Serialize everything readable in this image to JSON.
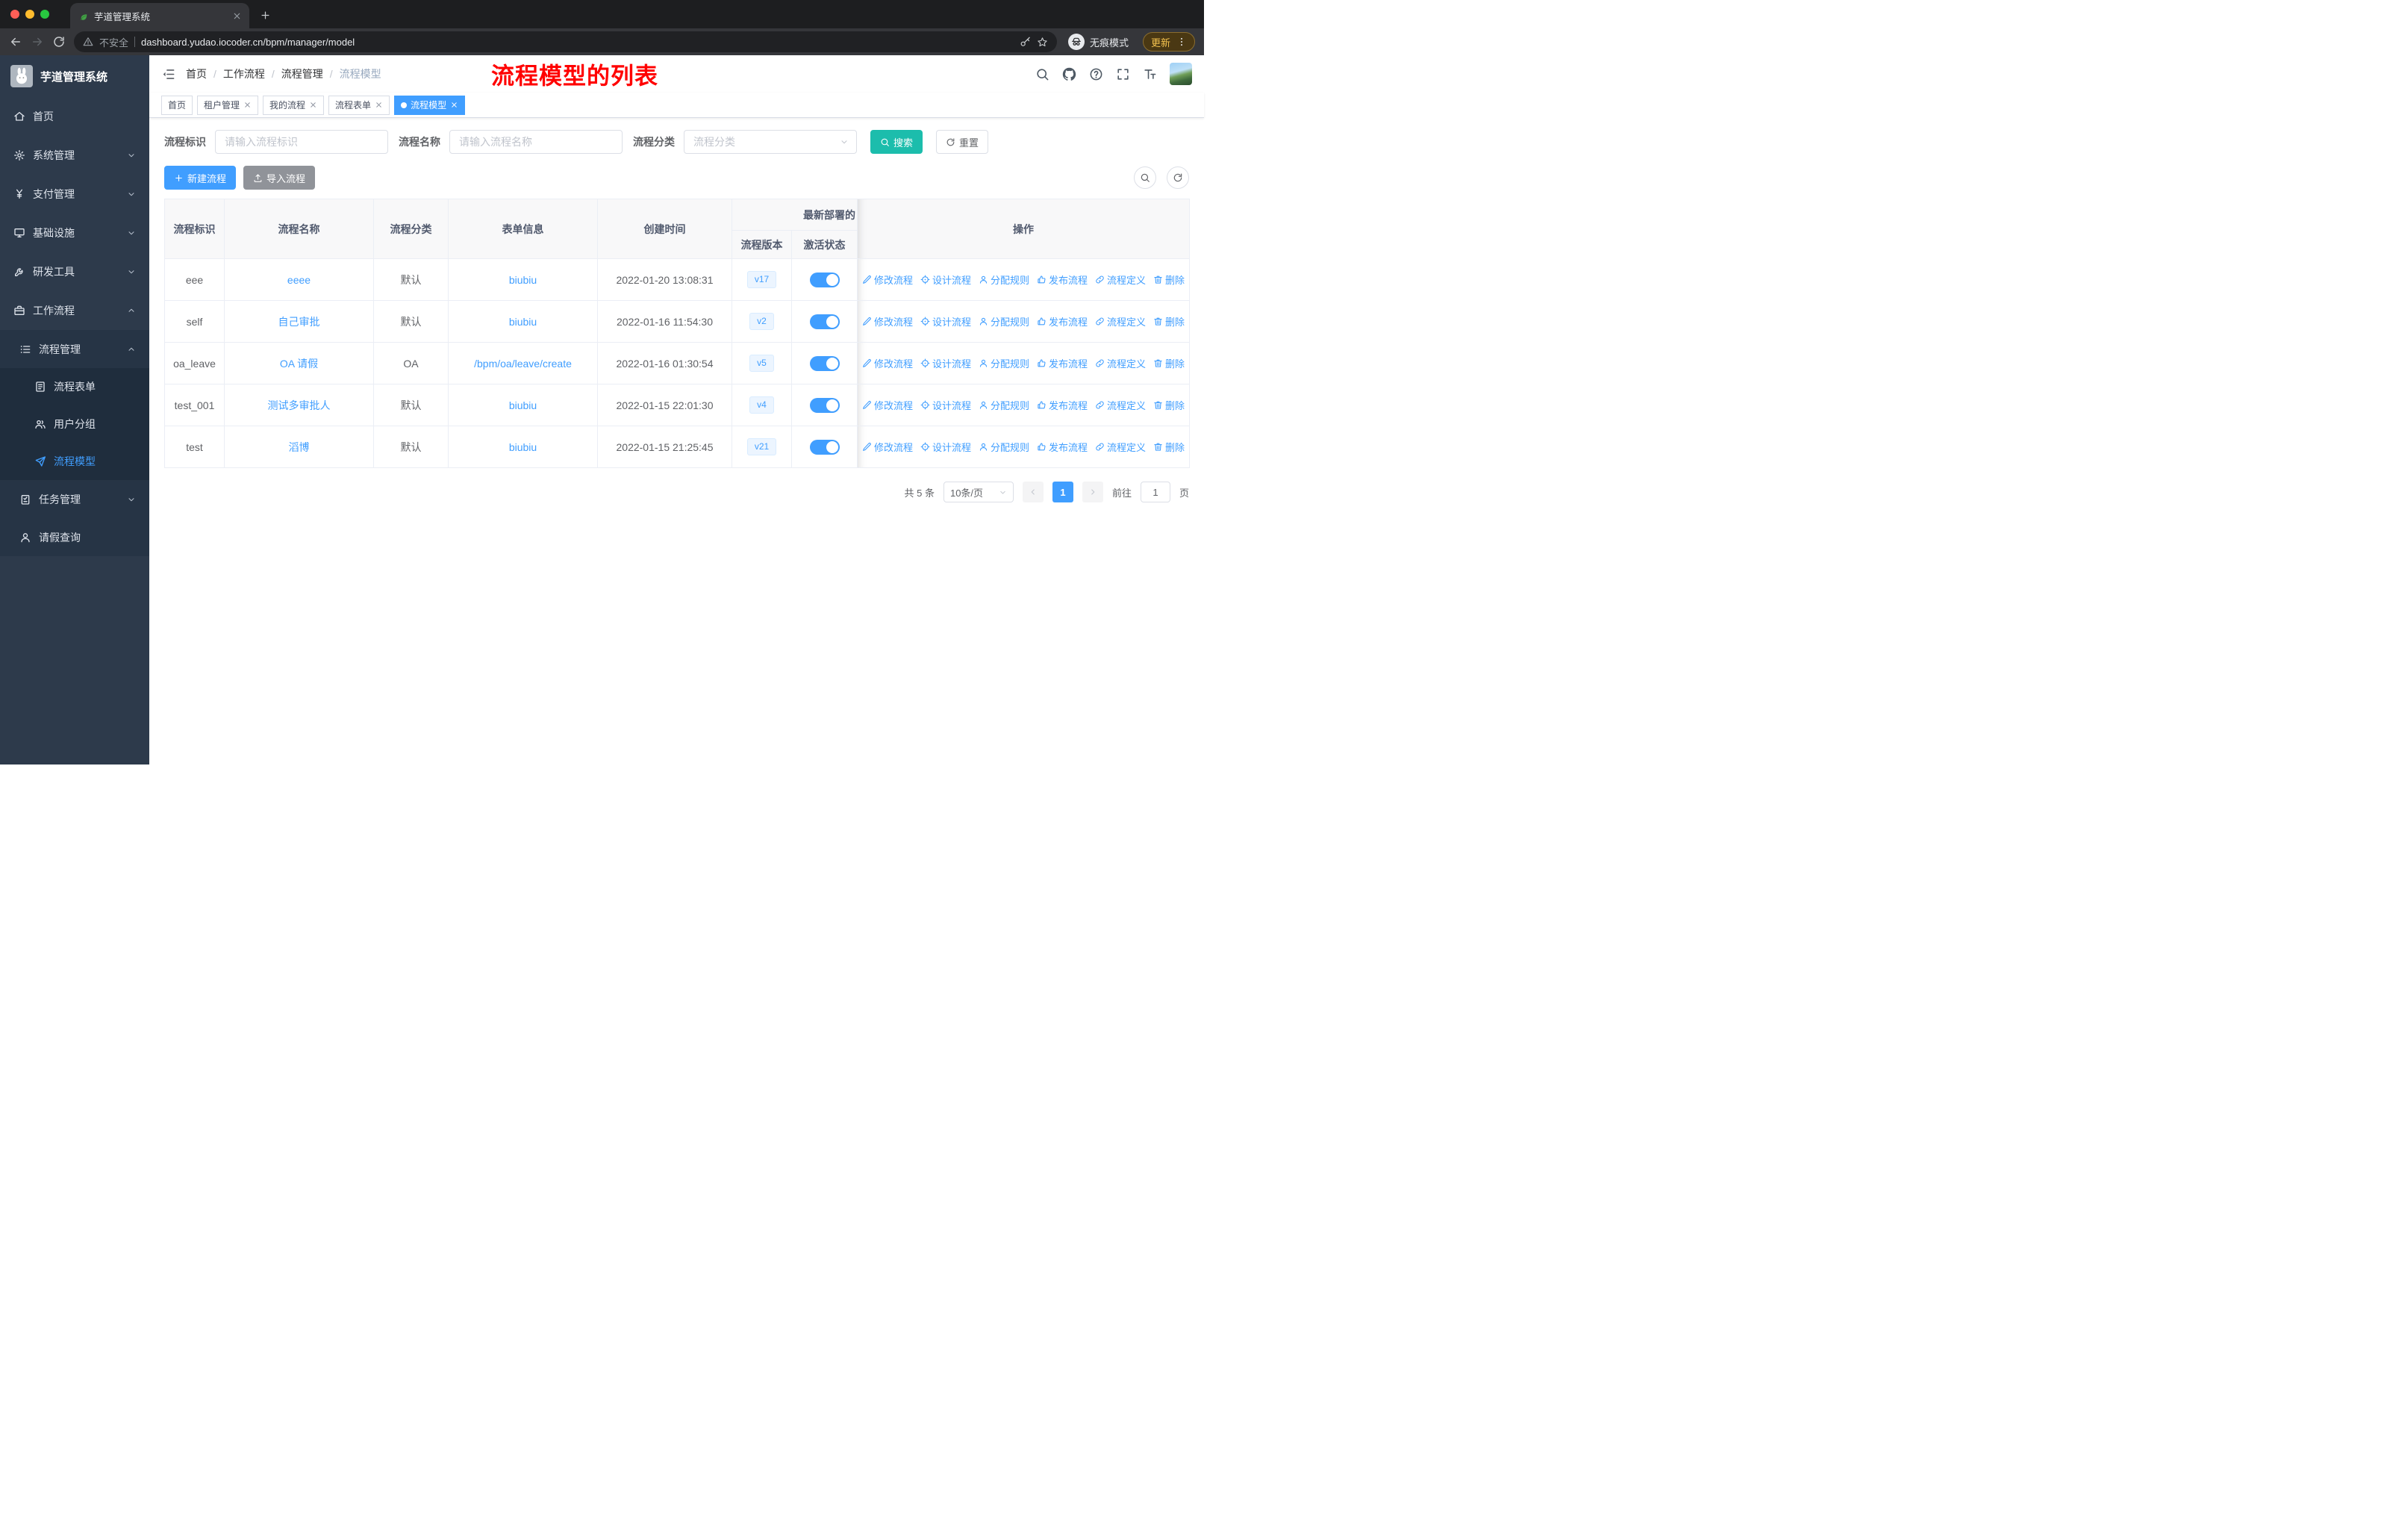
{
  "colors": {
    "primary": "#409EFF",
    "search_btn": "#1CBDAC",
    "red": "#FF0000",
    "sidebar_bg": "#2D3A4B"
  },
  "browser": {
    "tab_title": "芋道管理系统",
    "security_label": "不安全",
    "url": "dashboard.yudao.iocoder.cn/bpm/manager/model",
    "incognito_label": "无痕模式",
    "update_label": "更新"
  },
  "sidebar": {
    "app_title": "芋道管理系统",
    "items": [
      {
        "label": "首页"
      },
      {
        "label": "系统管理"
      },
      {
        "label": "支付管理"
      },
      {
        "label": "基础设施"
      },
      {
        "label": "研发工具"
      },
      {
        "label": "工作流程"
      },
      {
        "label": "流程管理"
      },
      {
        "label": "流程表单"
      },
      {
        "label": "用户分组"
      },
      {
        "label": "流程模型"
      },
      {
        "label": "任务管理"
      },
      {
        "label": "请假查询"
      }
    ]
  },
  "header": {
    "breadcrumb": [
      "首页",
      "工作流程",
      "流程管理",
      "流程模型"
    ],
    "sep": "/",
    "annotation": "流程模型的列表"
  },
  "tags": [
    {
      "label": "首页"
    },
    {
      "label": "租户管理"
    },
    {
      "label": "我的流程"
    },
    {
      "label": "流程表单"
    },
    {
      "label": "流程模型"
    }
  ],
  "filters": {
    "key_label": "流程标识",
    "key_placeholder": "请输入流程标识",
    "name_label": "流程名称",
    "name_placeholder": "请输入流程名称",
    "category_label": "流程分类",
    "category_placeholder": "流程分类",
    "search_label": "搜索",
    "reset_label": "重置"
  },
  "toolbar": {
    "create_label": "新建流程",
    "import_label": "导入流程"
  },
  "table": {
    "headers": {
      "key": "流程标识",
      "name": "流程名称",
      "category": "流程分类",
      "form": "表单信息",
      "created": "创建时间",
      "group": "最新部署的",
      "version": "流程版本",
      "active": "激活状态",
      "actions": "操作"
    },
    "actions": [
      "修改流程",
      "设计流程",
      "分配规则",
      "发布流程",
      "流程定义",
      "删除"
    ],
    "rows": [
      {
        "key": "eee",
        "name": "eeee",
        "category": "默认",
        "form": "biubiu",
        "created": "2022-01-20 13:08:31",
        "version": "v17"
      },
      {
        "key": "self",
        "name": "自己审批",
        "category": "默认",
        "form": "biubiu",
        "created": "2022-01-16 11:54:30",
        "version": "v2"
      },
      {
        "key": "oa_leave",
        "name": "OA 请假",
        "category": "OA",
        "form": "/bpm/oa/leave/create",
        "created": "2022-01-16 01:30:54",
        "version": "v5"
      },
      {
        "key": "test_001",
        "name": "测试多审批人",
        "category": "默认",
        "form": "biubiu",
        "created": "2022-01-15 22:01:30",
        "version": "v4"
      },
      {
        "key": "test",
        "name": "滔博",
        "category": "默认",
        "form": "biubiu",
        "created": "2022-01-15 21:25:45",
        "version": "v21"
      }
    ]
  },
  "pagination": {
    "total": "共 5 条",
    "page_size": "10条/页",
    "current_page": "1",
    "goto_label": "前往",
    "goto_value": "1",
    "page_unit": "页"
  }
}
